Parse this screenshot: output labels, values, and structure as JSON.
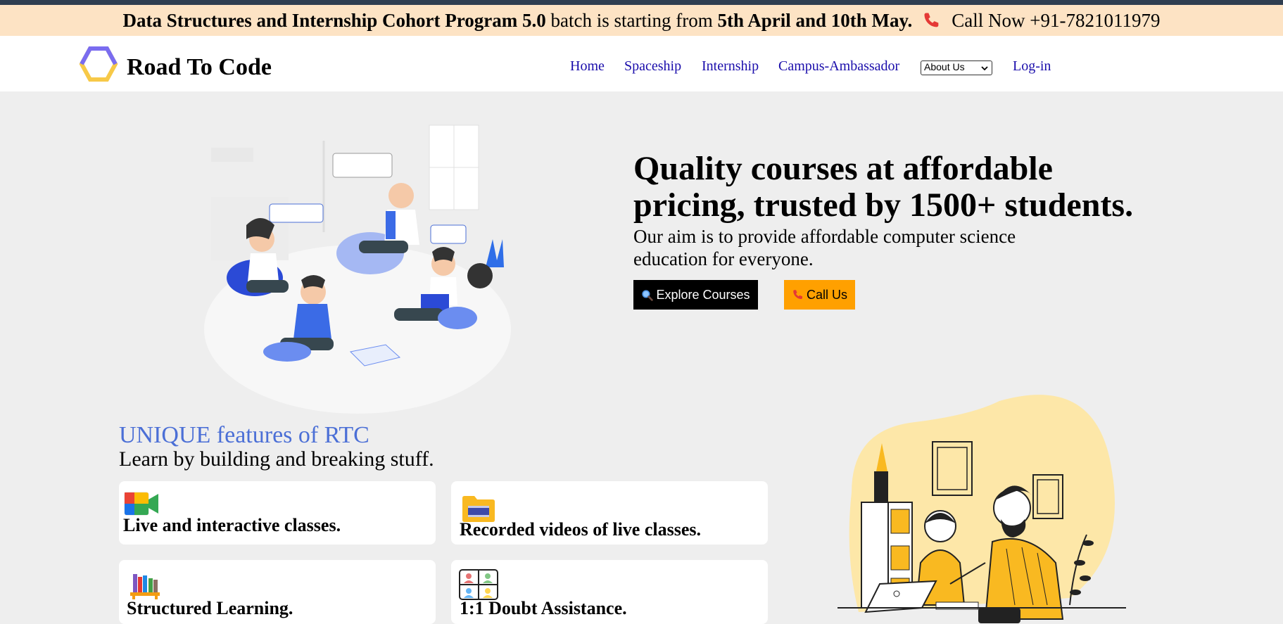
{
  "announcement": {
    "program": "Data Structures and Internship Cohort Program 5.0",
    "mid": " batch is starting from ",
    "dates": "5th April and 10th May.",
    "call": "Call Now +91-7821011979"
  },
  "navbar": {
    "brand": "Road To Code",
    "links": [
      "Home",
      "Spaceship",
      "Internship",
      "Campus-Ambassador"
    ],
    "about_select": "About Us",
    "login": "Log-in"
  },
  "hero": {
    "title": "Quality courses at affordable pricing, trusted by 1500+ students.",
    "subtitle": "Our aim is to provide affordable computer science education for everyone.",
    "explore_button": "Explore Courses",
    "call_button": "Call Us"
  },
  "features": {
    "title": "UNIQUE features of RTC",
    "subtitle": "Learn by building and breaking stuff.",
    "cards": [
      "Live and interactive classes.",
      "Recorded videos of live classes.",
      "Structured Learning.",
      "1:1 Doubt Assistance."
    ]
  },
  "colors": {
    "announcement_bg": "#fde3c4",
    "accent_blue": "#4b6fd6",
    "call_button": "#ffa000",
    "link": "#1a0dab"
  },
  "icons": [
    "phone-icon",
    "logo-hexagon-icon",
    "magnifier-icon",
    "video-call-icon",
    "folder-video-icon",
    "books-icon",
    "people-grid-icon"
  ]
}
